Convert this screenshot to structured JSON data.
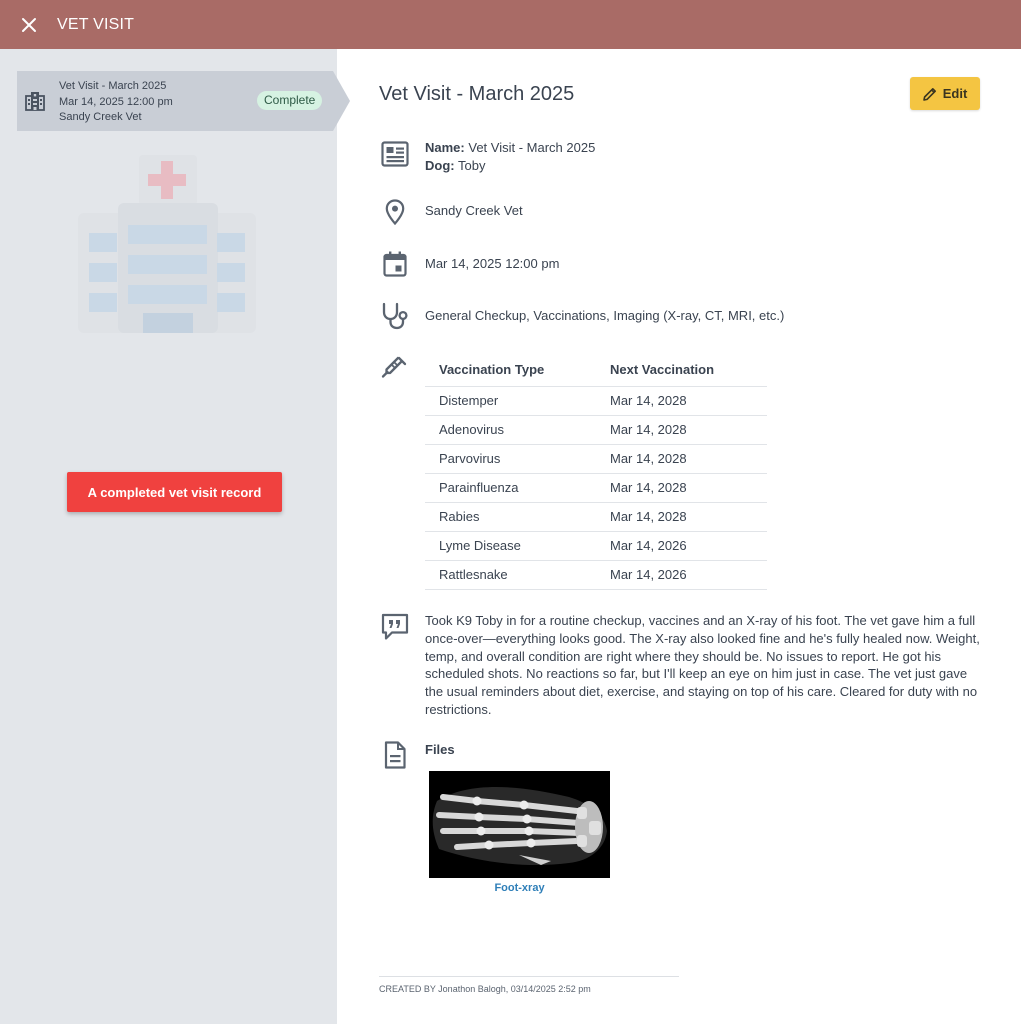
{
  "header": {
    "title": "VET VISIT",
    "close_icon": "close-icon"
  },
  "sidebar": {
    "card": {
      "icon": "hospital-building-icon",
      "line1": "Vet Visit - March 2025",
      "line2": "Mar 14, 2025 12:00 pm",
      "line3": "Sandy Creek Vet",
      "status": "Complete"
    },
    "illustration": "hospital-illustration",
    "tooltip": "A completed vet visit record"
  },
  "main": {
    "title": "Vet Visit - March 2025",
    "edit_label": "Edit",
    "name_label": "Name:",
    "name_value": "Vet Visit - March 2025",
    "dog_label": "Dog:",
    "dog_value": "Toby",
    "location": "Sandy Creek Vet",
    "datetime": "Mar 14, 2025 12:00 pm",
    "services": "General Checkup, Vaccinations, Imaging (X-ray, CT, MRI, etc.)",
    "vaccinations": {
      "headers": [
        "Vaccination Type",
        "Next Vaccination"
      ],
      "rows": [
        [
          "Distemper",
          "Mar 14, 2028"
        ],
        [
          "Adenovirus",
          "Mar 14, 2028"
        ],
        [
          "Parvovirus",
          "Mar 14, 2028"
        ],
        [
          "Parainfluenza",
          "Mar 14, 2028"
        ],
        [
          "Rabies",
          "Mar 14, 2028"
        ],
        [
          "Lyme Disease",
          "Mar 14, 2026"
        ],
        [
          "Rattlesnake",
          "Mar 14, 2026"
        ]
      ]
    },
    "notes": "Took K9 Toby in for a routine checkup, vaccines and an X-ray of his foot. The vet gave him a full once-over—everything looks good. The X-ray also looked fine and he's fully healed now. Weight, temp, and overall condition are right where they should be. No issues to report. He got his scheduled shots. No reactions so far, but I'll keep an eye on him just in case. The vet just gave the usual reminders about diet, exercise, and staying on top of his care. Cleared for duty with no restrictions.",
    "files_label": "Files",
    "file_name": "Foot-xray",
    "footer": "CREATED BY Jonathon Balogh, 03/14/2025 2:52 pm"
  },
  "colors": {
    "header_bg": "#a96b66",
    "sidebar_bg": "#e3e6ea",
    "card_bg": "#c9ced6",
    "badge_bg": "#d6f2e2",
    "tooltip_bg": "#f0413f",
    "edit_bg": "#f4c542",
    "link": "#2f7fb8"
  }
}
